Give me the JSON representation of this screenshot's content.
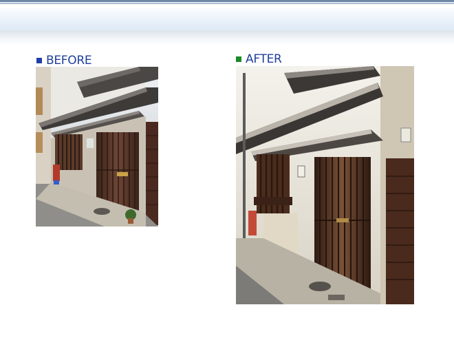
{
  "before": {
    "label": "BEFORE",
    "bullet_color": "#1f3fa6"
  },
  "after": {
    "label": "AFTER",
    "bullet_color": "#1a8a2a"
  },
  "colors": {
    "title_text": "#1e3f9a",
    "header_rule": "#6f87a6"
  }
}
